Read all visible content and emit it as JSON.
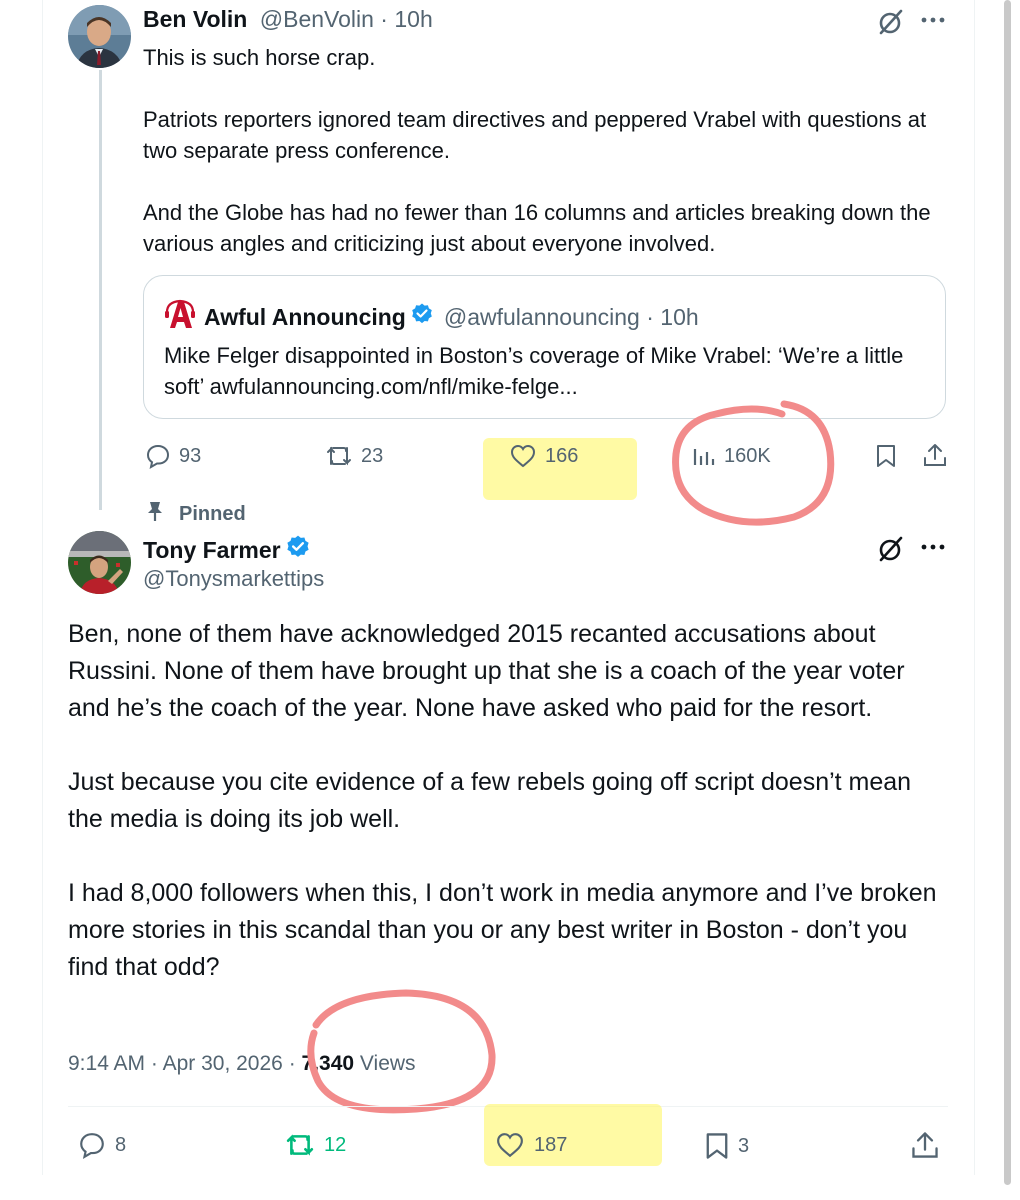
{
  "original_tweet": {
    "display_name": "Ben Volin",
    "handle": "@BenVolin",
    "time": "10h",
    "paragraphs": [
      "This is such horse crap.",
      "Patriots reporters ignored team directives and peppered Vrabel with questions at two separate press conference.",
      "And the Globe has had no fewer than 16 columns and articles breaking down the various angles and criticizing just about everyone involved."
    ],
    "quote": {
      "display_name": "Awful Announcing",
      "handle": "@awfulannouncing",
      "time": "10h",
      "text": "Mike Felger disappointed in Boston’s coverage of Mike Vrabel: ‘We’re a little soft’ awfulannouncing.com/nfl/mike-felge..."
    },
    "actions": {
      "replies": "93",
      "reposts": "23",
      "likes": "166",
      "views": "160K"
    }
  },
  "reply_tweet": {
    "pinned_label": "Pinned",
    "display_name": "Tony Farmer",
    "handle": "@Tonysmarkettips",
    "paragraphs": [
      "Ben, none of them have acknowledged 2015 recanted accusations about Russini. None of them have brought up that she is a coach of the year voter and he’s the coach of the year. None have asked who paid for the resort.",
      "Just because you cite evidence of a few rebels going off script doesn’t mean the media is doing its job well.",
      "I had 8,000 followers when this, I don’t work in media anymore and I’ve broken more stories in this scandal than you or any best writer in Boston - don’t you find that odd?"
    ],
    "time": "9:14 AM",
    "date": "Apr 30, 2026",
    "views_count": "7,340",
    "views_label": "Views",
    "actions": {
      "replies": "8",
      "reposts": "12",
      "likes": "187",
      "bookmarks": "3"
    }
  },
  "colors": {
    "text": "#0f1419",
    "muted": "#536471",
    "verified": "#1d9bf0",
    "repost_active": "#00ba7c",
    "highlight_yellow": "#fff55a",
    "annotation_red": "#f28b8b"
  },
  "icons": [
    "grok-icon",
    "more-icon",
    "reply-icon",
    "repost-icon",
    "like-icon",
    "views-icon",
    "bookmark-icon",
    "share-icon",
    "pin-icon",
    "verified-icon"
  ]
}
